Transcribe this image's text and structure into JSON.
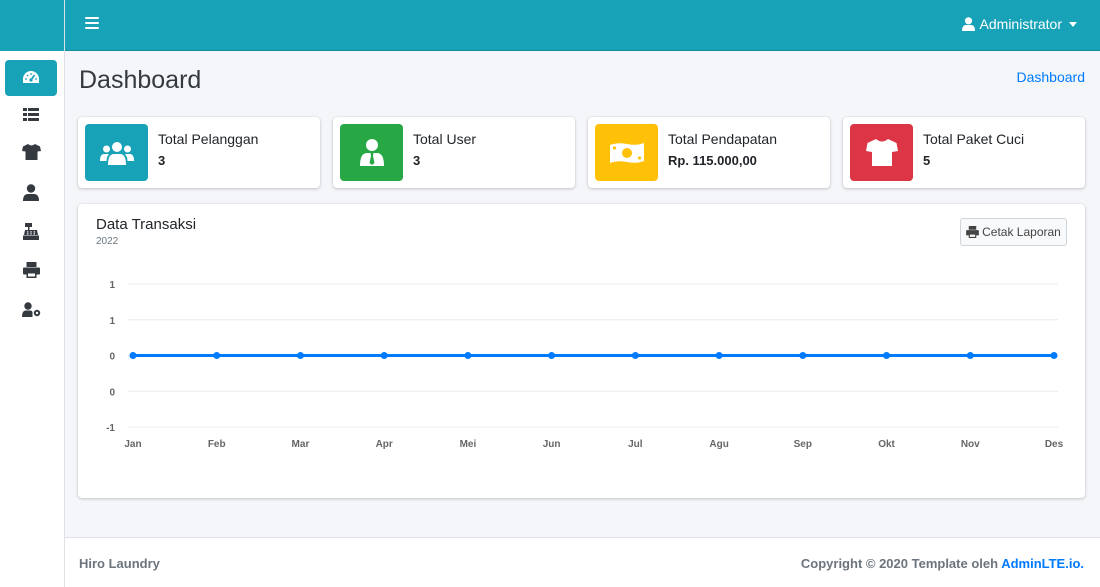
{
  "topbar": {
    "user_name": "Administrator"
  },
  "sidebar": {
    "items": [
      {
        "icon": "dashboard-icon",
        "active": true
      },
      {
        "icon": "list-icon",
        "active": false
      },
      {
        "icon": "tshirt-icon",
        "active": false
      },
      {
        "icon": "user-icon",
        "active": false
      },
      {
        "icon": "cash-register-icon",
        "active": false
      },
      {
        "icon": "print-icon",
        "active": false
      },
      {
        "icon": "user-cog-icon",
        "active": false
      }
    ]
  },
  "header": {
    "title": "Dashboard",
    "breadcrumb": "Dashboard"
  },
  "info_boxes": [
    {
      "label": "Total Pelanggan",
      "value": "3",
      "color": "#17a2b8",
      "icon": "users-icon"
    },
    {
      "label": "Total User",
      "value": "3",
      "color": "#28a745",
      "icon": "user-tie-icon"
    },
    {
      "label": "Total Pendapatan",
      "value": "Rp. 115.000,00",
      "color": "#ffc107",
      "icon": "money-bill-icon"
    },
    {
      "label": "Total Paket Cuci",
      "value": "5",
      "color": "#dc3545",
      "icon": "tshirt-icon"
    }
  ],
  "card": {
    "title": "Data Transaksi",
    "subtitle": "2022",
    "print_button": "Cetak Laporan"
  },
  "chart_data": {
    "type": "line",
    "categories": [
      "Jan",
      "Feb",
      "Mar",
      "Apr",
      "Mei",
      "Jun",
      "Jul",
      "Agu",
      "Sep",
      "Okt",
      "Nov",
      "Des"
    ],
    "series": [
      {
        "values": [
          0,
          0,
          0,
          0,
          0,
          0,
          0,
          0,
          0,
          0,
          0,
          0
        ]
      }
    ],
    "ytick_labels": [
      "1",
      "1",
      "0",
      "0",
      "-1"
    ],
    "ylim": [
      -1,
      1
    ],
    "grid": true,
    "color": "#007bff"
  },
  "footer": {
    "left": "Hiro Laundry",
    "right_prefix": "Copyright © 2020 Template oleh ",
    "right_link": "AdminLTE.io."
  }
}
